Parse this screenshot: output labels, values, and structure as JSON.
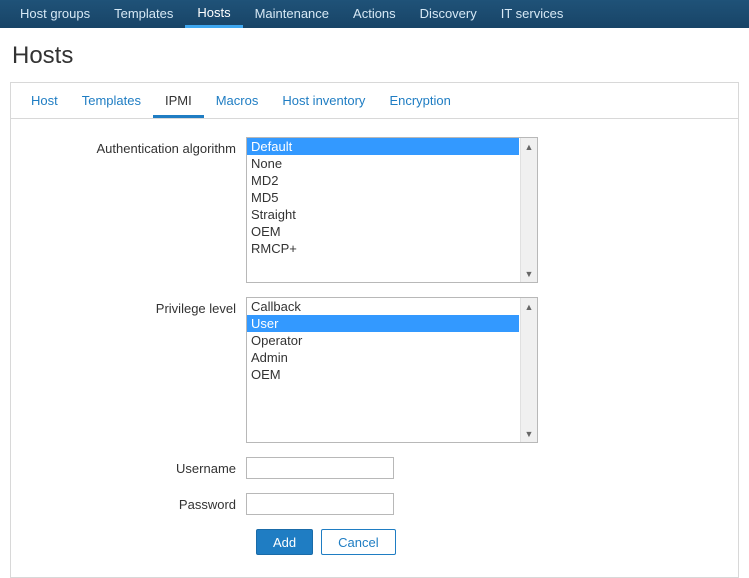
{
  "topnav": {
    "items": [
      {
        "label": "Host groups"
      },
      {
        "label": "Templates"
      },
      {
        "label": "Hosts",
        "active": true
      },
      {
        "label": "Maintenance"
      },
      {
        "label": "Actions"
      },
      {
        "label": "Discovery"
      },
      {
        "label": "IT services"
      }
    ]
  },
  "page_title": "Hosts",
  "subtabs": [
    {
      "label": "Host"
    },
    {
      "label": "Templates"
    },
    {
      "label": "IPMI",
      "active": true
    },
    {
      "label": "Macros"
    },
    {
      "label": "Host inventory"
    },
    {
      "label": "Encryption"
    }
  ],
  "form": {
    "auth_label": "Authentication algorithm",
    "auth_options": [
      "Default",
      "None",
      "MD2",
      "MD5",
      "Straight",
      "OEM",
      "RMCP+"
    ],
    "auth_selected": "Default",
    "priv_label": "Privilege level",
    "priv_options": [
      "Callback",
      "User",
      "Operator",
      "Admin",
      "OEM"
    ],
    "priv_selected": "User",
    "username_label": "Username",
    "username_value": "",
    "password_label": "Password",
    "password_value": "",
    "add_label": "Add",
    "cancel_label": "Cancel"
  }
}
